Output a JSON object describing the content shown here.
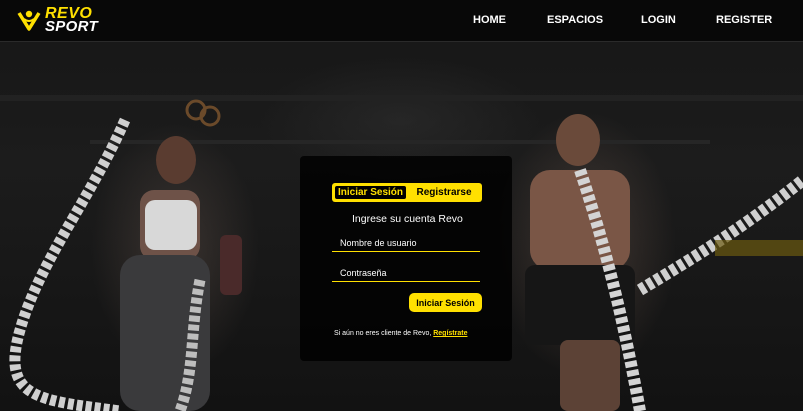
{
  "brand": {
    "name_line1": "REVO",
    "name_line2": "SPORT",
    "accent_color": "#ffe000",
    "logo_icon": "person-chevron-logo-icon"
  },
  "nav": {
    "items": [
      {
        "label": "HOME"
      },
      {
        "label": "ESPACIOS"
      },
      {
        "label": "LOGIN"
      },
      {
        "label": "REGISTER"
      }
    ]
  },
  "login": {
    "tabs": [
      {
        "label": "Iniciar Sesión",
        "active": true
      },
      {
        "label": "Registrarse",
        "active": false
      }
    ],
    "heading": "Ingrese su cuenta Revo",
    "username_placeholder": "Nombre de usuario",
    "password_placeholder": "Contraseña",
    "submit_label": "Iniciar Sesión",
    "signup_prompt": "Si aún no eres cliente de Revo, ",
    "signup_link": "Regístrate"
  }
}
